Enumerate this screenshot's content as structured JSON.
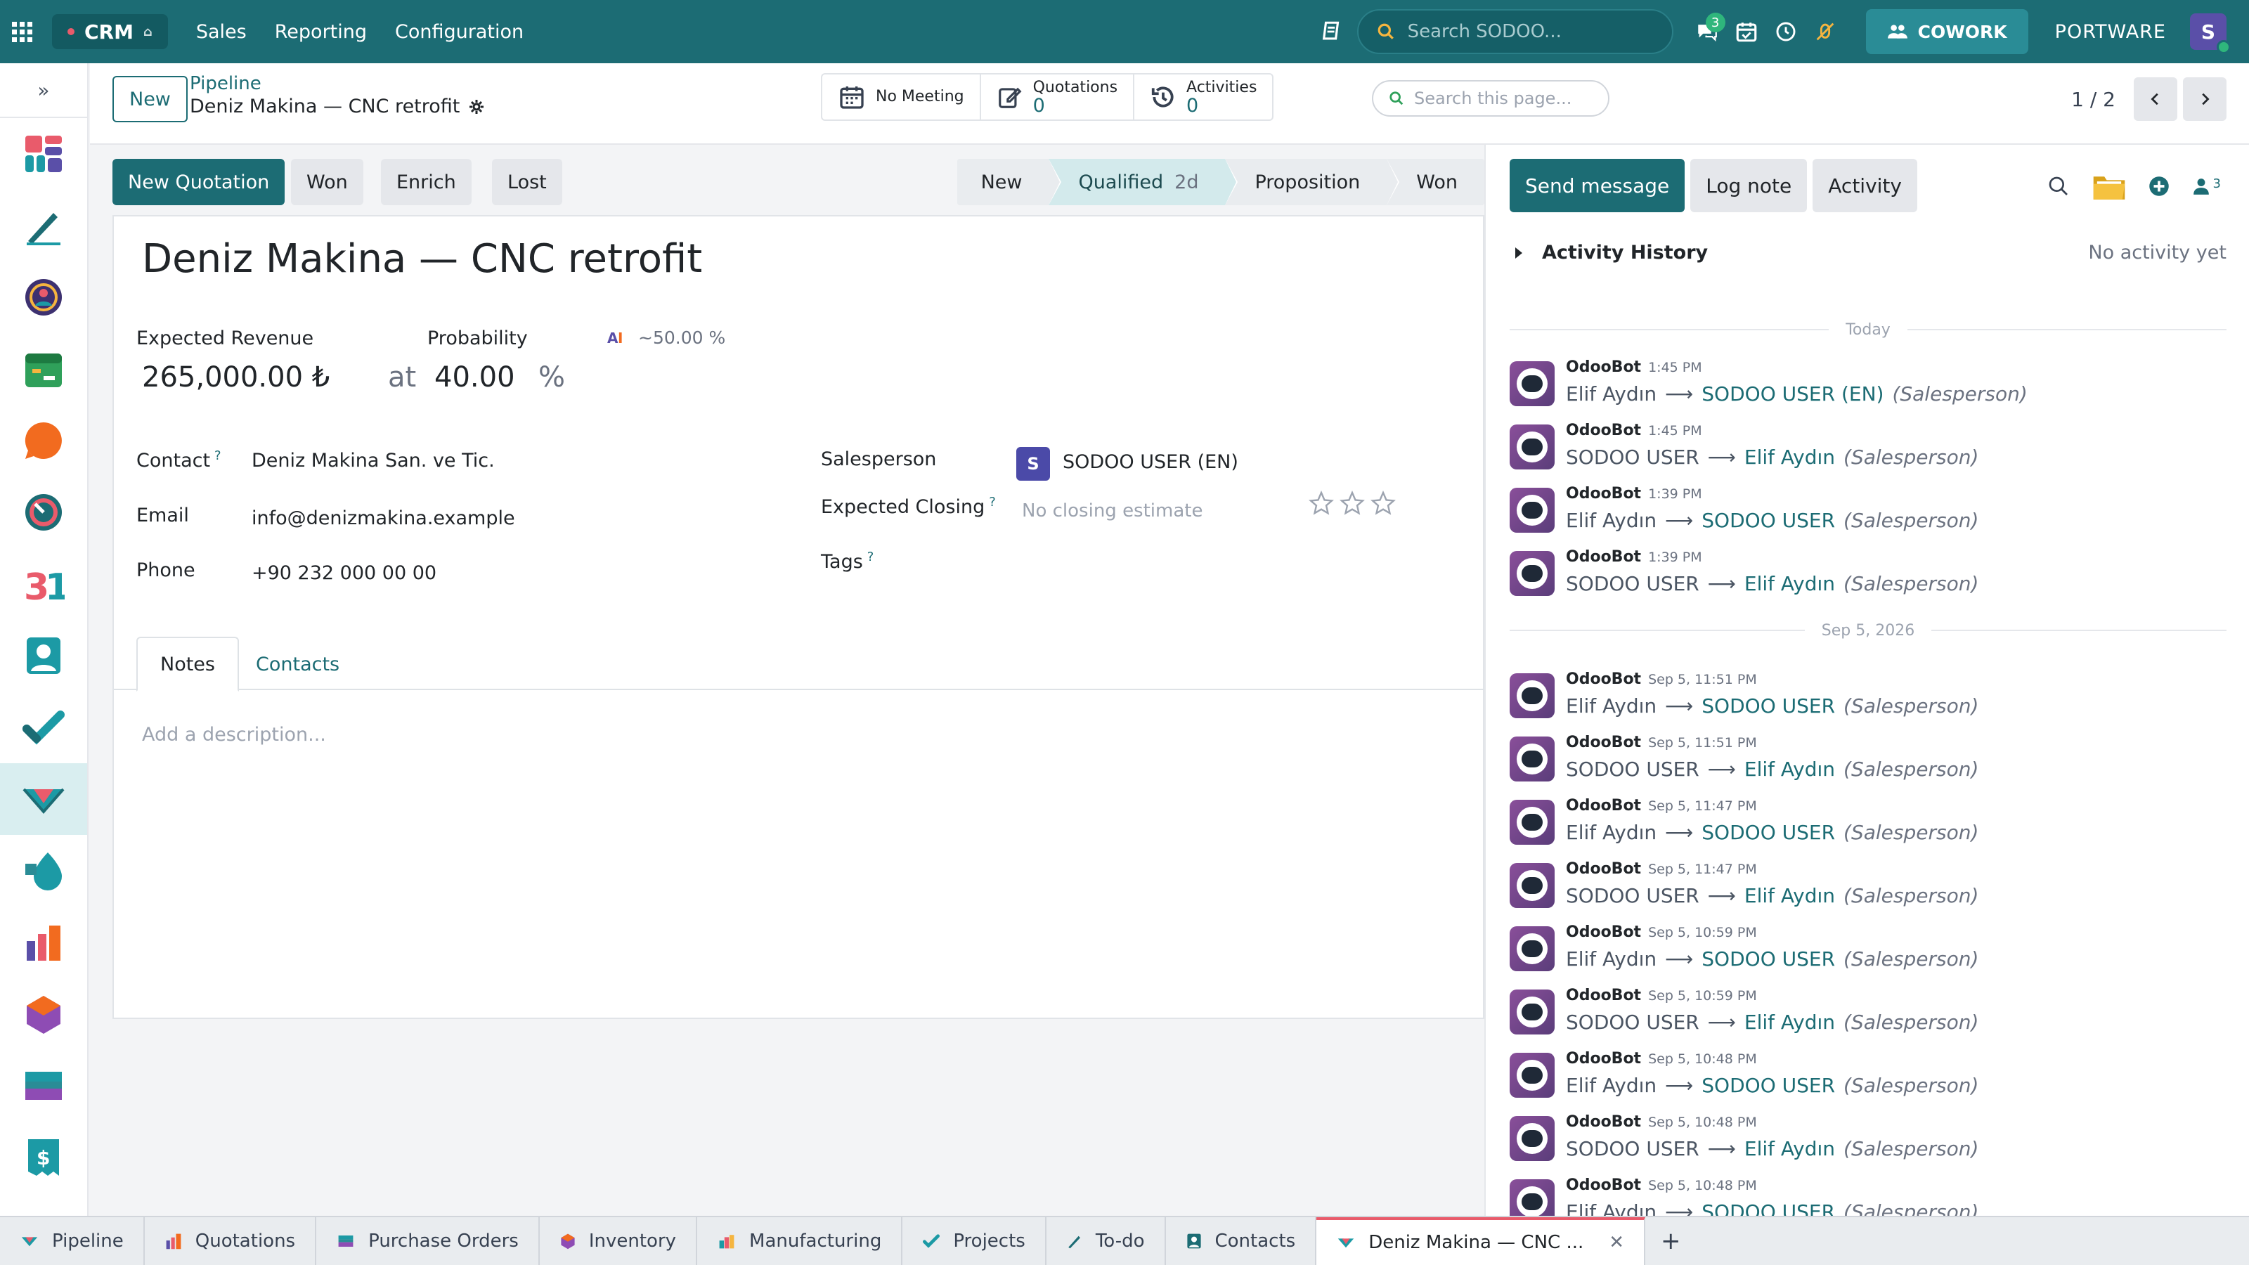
{
  "topbar": {
    "app": "CRM",
    "menu": [
      "Sales",
      "Reporting",
      "Configuration"
    ],
    "search_placeholder": "Search SODOO...",
    "chat_badge": "3",
    "cowork": "COWORK",
    "company": "PORTWARE",
    "avatar": "S"
  },
  "control": {
    "new": "New",
    "crumb_parent": "Pipeline",
    "crumb_current": "Deniz Makina — CNC retrofit",
    "meeting": "No Meeting",
    "quotations_label": "Quotations",
    "quotations_value": "0",
    "activities_label": "Activities",
    "activities_value": "0",
    "page_search_placeholder": "Search this page...",
    "pager": "1 / 2"
  },
  "actions": [
    "New Quotation",
    "Won",
    "Enrich",
    "Lost"
  ],
  "stages": [
    {
      "label": "New",
      "duration": ""
    },
    {
      "label": "Qualified",
      "duration": "2d"
    },
    {
      "label": "Proposition",
      "duration": ""
    },
    {
      "label": "Won",
      "duration": ""
    }
  ],
  "form": {
    "title": "Deniz Makina — CNC retrofit",
    "expected_revenue_label": "Expected Revenue",
    "expected_revenue": "265,000.00 ₺",
    "probability_label": "Probability",
    "ai_probability": "~50.00 %",
    "at": "at",
    "probability": "40.00",
    "percent": "%",
    "contact_label": "Contact",
    "contact": "Deniz Makina San. ve Tic.",
    "email_label": "Email",
    "email": "info@denizmakina.example",
    "phone_label": "Phone",
    "phone": "+90 232 000 00 00",
    "salesperson_label": "Salesperson",
    "salesperson_avatar": "S",
    "salesperson": "SODOO USER (EN)",
    "closing_label": "Expected Closing",
    "closing_placeholder": "No closing estimate",
    "tags_label": "Tags",
    "help_mark": "?",
    "tabs": [
      "Notes",
      "Contacts"
    ],
    "description_placeholder": "Add a description..."
  },
  "chatter": {
    "buttons": [
      "Send message",
      "Log note",
      "Activity"
    ],
    "followers": "3",
    "activity_history": "Activity History",
    "no_activity": "No activity yet",
    "sep_today": "Today",
    "sep_date": "Sep 5, 2026",
    "messages": [
      {
        "author": "OdooBot",
        "date": "1:45 PM",
        "from": "Elif Aydın",
        "to": "SODOO USER (EN)",
        "role": "(Salesperson)"
      },
      {
        "author": "OdooBot",
        "date": "1:45 PM",
        "from": "SODOO USER",
        "to": "Elif Aydın",
        "role": "(Salesperson)"
      },
      {
        "author": "OdooBot",
        "date": "1:39 PM",
        "from": "Elif Aydın",
        "to": "SODOO USER",
        "role": "(Salesperson)"
      },
      {
        "author": "OdooBot",
        "date": "1:39 PM",
        "from": "SODOO USER",
        "to": "Elif Aydın",
        "role": "(Salesperson)"
      },
      {
        "author": "OdooBot",
        "date": "Sep 5, 11:51 PM",
        "from": "Elif Aydın",
        "to": "SODOO USER",
        "role": "(Salesperson)"
      },
      {
        "author": "OdooBot",
        "date": "Sep 5, 11:51 PM",
        "from": "SODOO USER",
        "to": "Elif Aydın",
        "role": "(Salesperson)"
      },
      {
        "author": "OdooBot",
        "date": "Sep 5, 11:47 PM",
        "from": "Elif Aydın",
        "to": "SODOO USER",
        "role": "(Salesperson)"
      },
      {
        "author": "OdooBot",
        "date": "Sep 5, 11:47 PM",
        "from": "SODOO USER",
        "to": "Elif Aydın",
        "role": "(Salesperson)"
      },
      {
        "author": "OdooBot",
        "date": "Sep 5, 10:59 PM",
        "from": "Elif Aydın",
        "to": "SODOO USER",
        "role": "(Salesperson)"
      },
      {
        "author": "OdooBot",
        "date": "Sep 5, 10:59 PM",
        "from": "SODOO USER",
        "to": "Elif Aydın",
        "role": "(Salesperson)"
      },
      {
        "author": "OdooBot",
        "date": "Sep 5, 10:48 PM",
        "from": "Elif Aydın",
        "to": "SODOO USER",
        "role": "(Salesperson)"
      },
      {
        "author": "OdooBot",
        "date": "Sep 5, 10:48 PM",
        "from": "SODOO USER",
        "to": "Elif Aydın",
        "role": "(Salesperson)"
      },
      {
        "author": "OdooBot",
        "date": "Sep 5, 10:48 PM",
        "from": "Elif Aydın",
        "to": "SODOO USER",
        "role": "(Salesperson)"
      }
    ]
  },
  "bottom_tabs": [
    {
      "label": "Pipeline",
      "icon": "crm-icon",
      "color": "#1c9aa5"
    },
    {
      "label": "Quotations",
      "icon": "sales-icon",
      "color": "#e9743b"
    },
    {
      "label": "Purchase Orders",
      "icon": "purchase-icon",
      "color": "#2a8c96"
    },
    {
      "label": "Inventory",
      "icon": "inventory-icon",
      "color": "#8e4cb4"
    },
    {
      "label": "Manufacturing",
      "icon": "manufacturing-icon",
      "color": "#e95b6b"
    },
    {
      "label": "Projects",
      "icon": "project-icon",
      "color": "#1c9aa5"
    },
    {
      "label": "To-do",
      "icon": "todo-icon",
      "color": "#1c6c74"
    },
    {
      "label": "Contacts",
      "icon": "contacts-icon",
      "color": "#1c6c74"
    },
    {
      "label": "Deniz Makina — CNC ...",
      "icon": "crm-icon",
      "color": "#1c9aa5",
      "active": true
    }
  ],
  "colors": {
    "primary": "#1c6c74",
    "accent": "#e95b6b"
  }
}
